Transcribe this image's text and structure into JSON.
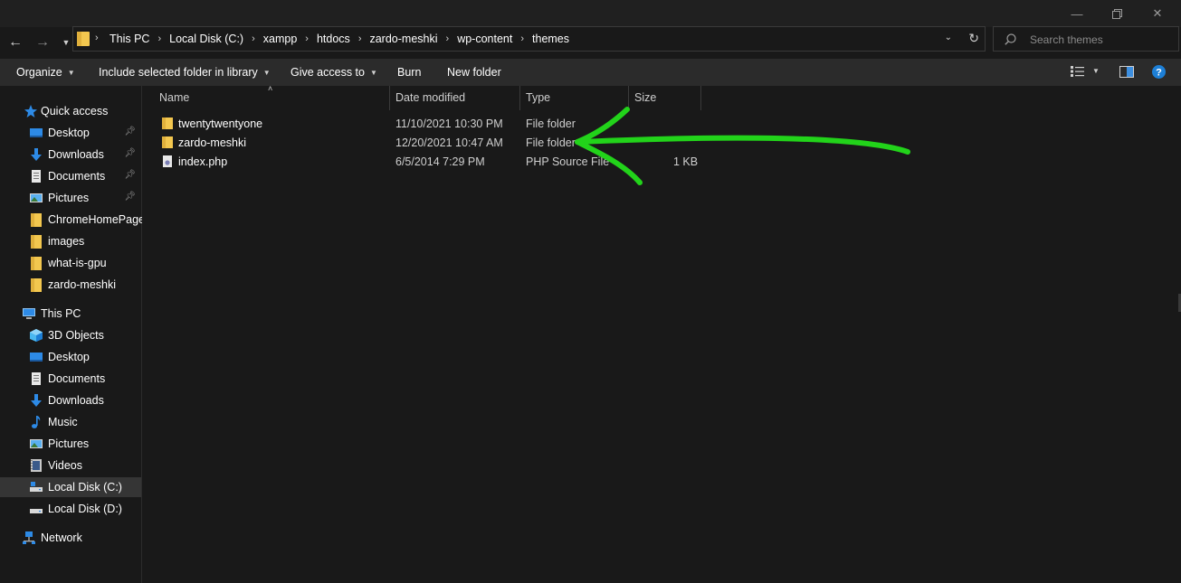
{
  "window": {
    "minimize_icon": "minimize-icon",
    "maximize_icon": "restore-icon",
    "close_icon": "close-icon"
  },
  "address": {
    "breadcrumbs": [
      "This PC",
      "Local Disk (C:)",
      "xampp",
      "htdocs",
      "zardo-meshki",
      "wp-content",
      "themes"
    ]
  },
  "search": {
    "placeholder": "Search themes"
  },
  "toolbar": {
    "organize": "Organize",
    "include_library": "Include selected folder in library",
    "give_access": "Give access to",
    "burn": "Burn",
    "new_folder": "New folder"
  },
  "sidebar": {
    "quick_access": "Quick access",
    "quick_items": [
      {
        "label": "Desktop",
        "icon": "desktop-icon",
        "pinned": true
      },
      {
        "label": "Downloads",
        "icon": "downloads-icon",
        "pinned": true
      },
      {
        "label": "Documents",
        "icon": "documents-icon",
        "pinned": true
      },
      {
        "label": "Pictures",
        "icon": "pictures-icon",
        "pinned": true
      },
      {
        "label": "ChromeHomePage",
        "icon": "folder-icon",
        "pinned": false
      },
      {
        "label": "images",
        "icon": "folder-icon",
        "pinned": false
      },
      {
        "label": "what-is-gpu",
        "icon": "folder-icon",
        "pinned": false
      },
      {
        "label": "zardo-meshki",
        "icon": "folder-icon",
        "pinned": false
      }
    ],
    "this_pc": "This PC",
    "pc_items": [
      {
        "label": "3D Objects",
        "icon": "3d-objects-icon"
      },
      {
        "label": "Desktop",
        "icon": "desktop-icon"
      },
      {
        "label": "Documents",
        "icon": "documents-icon"
      },
      {
        "label": "Downloads",
        "icon": "downloads-icon"
      },
      {
        "label": "Music",
        "icon": "music-icon"
      },
      {
        "label": "Pictures",
        "icon": "pictures-icon"
      },
      {
        "label": "Videos",
        "icon": "videos-icon"
      },
      {
        "label": "Local Disk (C:)",
        "icon": "drive-c-icon",
        "selected": true
      },
      {
        "label": "Local Disk (D:)",
        "icon": "drive-d-icon"
      }
    ],
    "network": "Network"
  },
  "columns": {
    "name": "Name",
    "date": "Date modified",
    "type": "Type",
    "size": "Size"
  },
  "files": [
    {
      "name": "twentytwentyone",
      "date": "11/10/2021 10:30 PM",
      "type": "File folder",
      "size": "",
      "icon": "folder-icon"
    },
    {
      "name": "zardo-meshki",
      "date": "12/20/2021 10:47 AM",
      "type": "File folder",
      "size": "",
      "icon": "folder-icon"
    },
    {
      "name": "index.php",
      "date": "6/5/2014 7:29 PM",
      "type": "PHP Source File",
      "size": "1 KB",
      "icon": "php-file-icon"
    }
  ],
  "colors": {
    "background": "#191919",
    "toolbar": "#2b2b2b",
    "folder": "#f3c74f",
    "annotation_arrow": "#22d31a",
    "accent": "#1d7fd6"
  }
}
